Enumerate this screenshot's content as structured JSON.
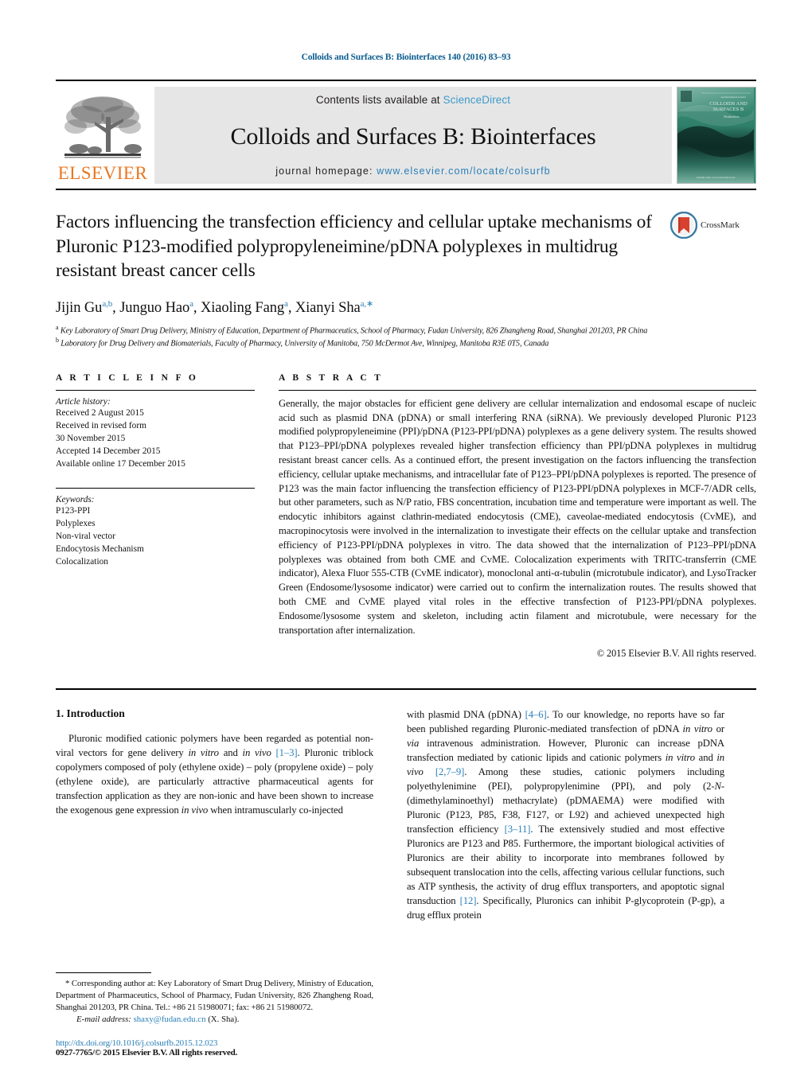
{
  "running_head": "Colloids and Surfaces B: Biointerfaces 140 (2016) 83–93",
  "masthead": {
    "publisher_name": "ELSEVIER",
    "contents_prefix": "Contents lists available at ",
    "contents_link": "ScienceDirect",
    "journal_title": "Colloids and Surfaces B: Biointerfaces",
    "homepage_prefix": "journal homepage: ",
    "homepage_url": "www.elsevier.com/locate/colsurfb",
    "cover_alt": "Colloids and Surfaces B journal cover"
  },
  "article": {
    "title": "Factors influencing the transfection efficiency and cellular uptake mechanisms of Pluronic P123-modified polypropyleneimine/pDNA polyplexes in multidrug resistant breast cancer cells",
    "crossmark_label": "CrossMark",
    "authors_html": "Jijin Gu<sup>a,b</sup>, Junguo Hao<sup>a</sup>, Xiaoling Fang<sup>a</sup>, Xianyi Sha<sup>a,∗</sup>",
    "affiliation_a": "Key Laboratory of Smart Drug Delivery, Ministry of Education, Department of Pharmaceutics, School of Pharmacy, Fudan University, 826 Zhangheng Road, Shanghai 201203, PR China",
    "affiliation_b": "Laboratory for Drug Delivery and Biomaterials, Faculty of Pharmacy, University of Manitoba, 750 McDermot Ave, Winnipeg, Manitoba R3E 0T5, Canada"
  },
  "article_info": {
    "heading": "A R T I C L E   I N F O",
    "history_label": "Article history:",
    "history": [
      "Received 2 August 2015",
      "Received in revised form",
      "30 November 2015",
      "Accepted 14 December 2015",
      "Available online 17 December 2015"
    ],
    "keywords_label": "Keywords:",
    "keywords": [
      "P123-PPI",
      "Polyplexes",
      "Non-viral vector",
      "Endocytosis Mechanism",
      "Colocalization"
    ]
  },
  "abstract": {
    "heading": "A B S T R A C T",
    "text": "Generally, the major obstacles for efficient gene delivery are cellular internalization and endosomal escape of nucleic acid such as plasmid DNA (pDNA) or small interfering RNA (siRNA). We previously developed Pluronic P123 modified polypropyleneimine (PPI)/pDNA (P123-PPI/pDNA) polyplexes as a gene delivery system. The results showed that P123–PPI/pDNA polyplexes revealed higher transfection efficiency than PPI/pDNA polyplexes in multidrug resistant breast cancer cells. As a continued effort, the present investigation on the factors influencing the transfection efficiency, cellular uptake mechanisms, and intracellular fate of P123–PPI/pDNA polyplexes is reported. The presence of P123 was the main factor influencing the transfection efficiency of P123-PPI/pDNA polyplexes in MCF-7/ADR cells, but other parameters, such as N/P ratio, FBS concentration, incubation time and temperature were important as well. The endocytic inhibitors against clathrin-mediated endocytosis (CME), caveolae-mediated endocytosis (CvME), and macropinocytosis were involved in the internalization to investigate their effects on the cellular uptake and transfection efficiency of P123-PPI/pDNA polyplexes in vitro. The data showed that the internalization of P123–PPI/pDNA polyplexes was obtained from both CME and CvME. Colocalization experiments with TRITC-transferrin (CME indicator), Alexa Fluor 555-CTB (CvME indicator), monoclonal anti-α-tubulin (microtubule indicator), and LysoTracker Green (Endosome/lysosome indicator) were carried out to confirm the internalization routes. The results showed that both CME and CvME played vital roles in the effective transfection of P123-PPI/pDNA polyplexes. Endosome/lysosome system and skeleton, including actin filament and microtubule, were necessary for the transportation after internalization.",
    "copyright": "© 2015 Elsevier B.V. All rights reserved."
  },
  "introduction": {
    "section_number": "1.",
    "section_title": "Introduction",
    "left_paragraph_html": "Pluronic modified cationic polymers have been regarded as potential non-viral vectors for gene delivery <span class=\"it\">in vitro</span> and <span class=\"it\">in vivo</span> <span class=\"ref\">[1–3]</span>. Pluronic triblock copolymers composed of poly (ethylene oxide) – poly (propylene oxide) – poly (ethylene oxide), are particularly attractive pharmaceutical agents for transfection application as they are non-ionic and have been shown to increase the exogenous gene expression <span class=\"it\">in vivo</span> when intramuscularly co-injected",
    "right_paragraph_html": "with plasmid DNA (pDNA) <span class=\"ref\">[4–6]</span>. To our knowledge, no reports have so far been published regarding Pluronic-mediated transfection of pDNA <span class=\"it\">in vitro</span> or <span class=\"it\">via</span> intravenous administration. However, Pluronic can increase pDNA transfection mediated by cationic lipids and cationic polymers <span class=\"it\">in vitro</span> and <span class=\"it\">in vivo</span> <span class=\"ref\">[2,7–9]</span>. Among these studies, cationic polymers including polyethylenimine (PEI), polypropylenimine (PPI), and poly (2-<span class=\"it\">N</span>-(dimethylaminoethyl) methacrylate) (pDMAEMA) were modified with Pluronic (P123, P85, F38, F127, or L92) and achieved unexpected high transfection efficiency <span class=\"ref\">[3–11]</span>. The extensively studied and most effective Pluronics are P123 and P85. Furthermore, the important biological activities of Pluronics are their ability to incorporate into membranes followed by subsequent translocation into the cells, affecting various cellular functions, such as ATP synthesis, the activity of drug efflux transporters, and apoptotic signal transduction <span class=\"ref\">[12]</span>. Specifically, Pluronics can inhibit P-glycoprotein (P-gp), a drug efflux protein"
  },
  "footnote": {
    "corresponding": "* Corresponding author at: Key Laboratory of Smart Drug Delivery, Ministry of Education, Department of Pharmaceutics, School of Pharmacy, Fudan University, 826 Zhangheng Road, Shanghai 201203, PR China. Tel.: +86 21 51980071; fax: +86 21 51980072.",
    "email_label": "E-mail address:",
    "email": "shaxy@fudan.edu.cn",
    "email_suffix": "(X. Sha).",
    "doi": "http://dx.doi.org/10.1016/j.colsurfb.2015.12.023",
    "issn": "0927-7765/© 2015 Elsevier B.V. All rights reserved."
  },
  "colors": {
    "link_blue": "#2a7fb8",
    "running_head_blue": "#0b5d8f",
    "elsevier_orange": "#e87722",
    "masthead_gray": "#e6e6e6"
  }
}
